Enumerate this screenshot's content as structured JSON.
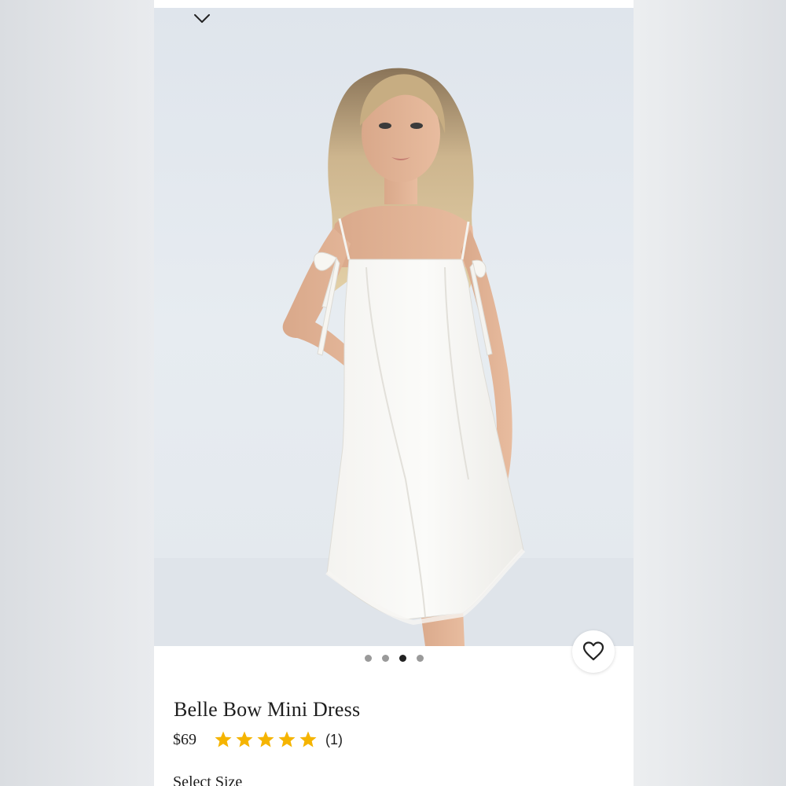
{
  "product": {
    "title": "Belle Bow Mini Dress",
    "price": "$69",
    "rating": 5,
    "rating_max": 5,
    "review_count": "(1)"
  },
  "gallery": {
    "image_count": 4,
    "active_index": 2,
    "image_alt": "Model wearing white satin mini dress with bow straps"
  },
  "size_selector": {
    "label": "Select Size"
  },
  "icons": {
    "collapse": "chevron-down-icon",
    "wishlist": "heart-icon",
    "star": "star-icon"
  },
  "colors": {
    "star": "#F5B400",
    "text": "#1E1E1E",
    "dot_active": "#222222",
    "dot_inactive": "#9A9A9A"
  }
}
